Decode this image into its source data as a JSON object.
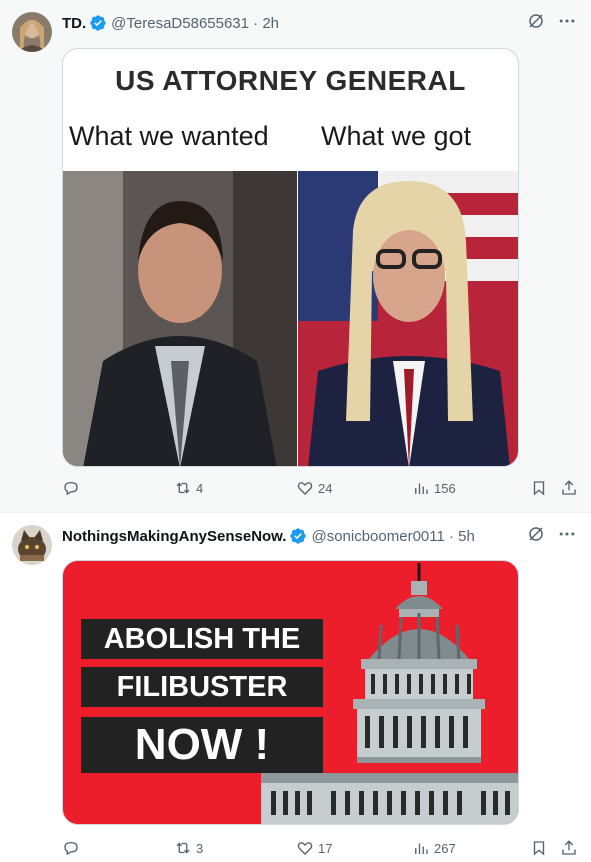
{
  "tweets": [
    {
      "name": "TD.",
      "handle": "@TeresaD58655631 · 2h",
      "meme": {
        "title": "US ATTORNEY GENERAL",
        "left_caption": "What we wanted",
        "right_caption": "What we got"
      },
      "stats": {
        "replies": "",
        "reposts": "4",
        "likes": "24",
        "views": "156"
      }
    },
    {
      "name": "NothingsMakingAnySenseNow.",
      "handle": "@sonicboomer0011 · 5h",
      "banner": {
        "line1": "ABOLISH THE",
        "line2": "FILIBUSTER",
        "line3": "NOW !"
      },
      "stats": {
        "replies": "",
        "reposts": "3",
        "likes": "17",
        "views": "267"
      }
    }
  ],
  "icons": {
    "verified": "verified-badge-icon",
    "grok": "grok-icon",
    "more": "more-icon",
    "reply": "reply-icon",
    "repost": "repost-icon",
    "like": "like-icon",
    "views": "views-icon",
    "bookmark": "bookmark-icon",
    "share": "share-icon"
  },
  "colors": {
    "verified": "#1d9bf0",
    "muted": "#536471",
    "banner_red": "#ec1e2c"
  }
}
